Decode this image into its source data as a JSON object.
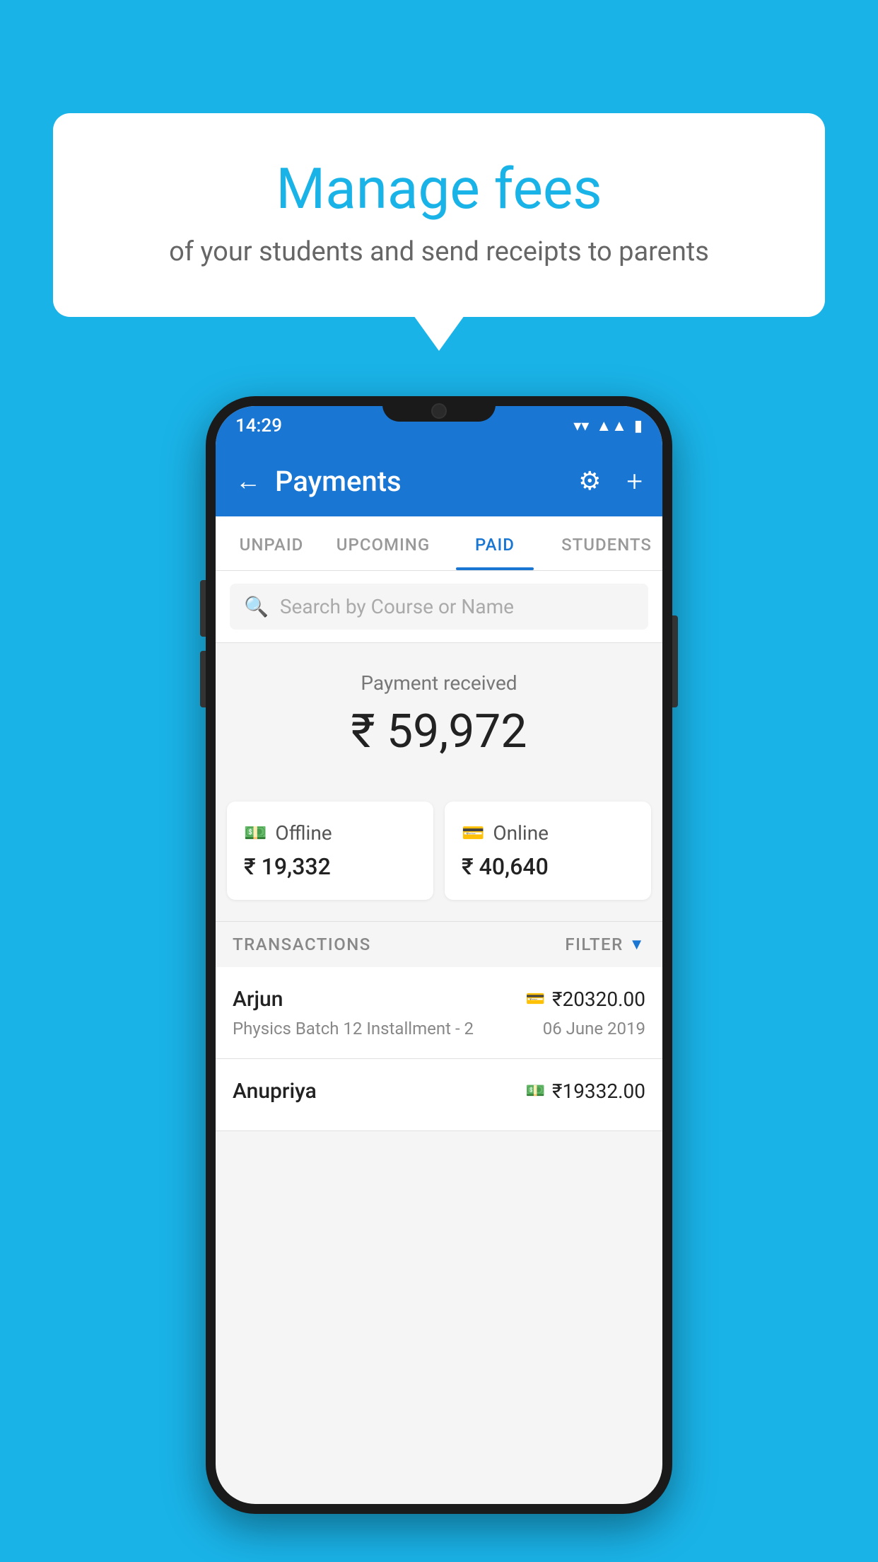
{
  "background_color": "#1ab3e8",
  "speech_bubble": {
    "title": "Manage fees",
    "subtitle": "of your students and send receipts to parents"
  },
  "phone": {
    "status_bar": {
      "time": "14:29",
      "wifi": "▾",
      "signal": "▲",
      "battery": "▮"
    },
    "header": {
      "back_label": "←",
      "title": "Payments",
      "gear_label": "⚙",
      "plus_label": "+"
    },
    "tabs": [
      {
        "label": "UNPAID",
        "active": false
      },
      {
        "label": "UPCOMING",
        "active": false
      },
      {
        "label": "PAID",
        "active": true
      },
      {
        "label": "STUDENTS",
        "active": false
      }
    ],
    "search": {
      "placeholder": "Search by Course or Name"
    },
    "payment_summary": {
      "label": "Payment received",
      "amount": "₹ 59,972",
      "offline_label": "Offline",
      "offline_amount": "₹ 19,332",
      "online_label": "Online",
      "online_amount": "₹ 40,640"
    },
    "transactions": {
      "section_label": "TRANSACTIONS",
      "filter_label": "FILTER",
      "items": [
        {
          "name": "Arjun",
          "amount": "₹20320.00",
          "detail": "Physics Batch 12 Installment - 2",
          "date": "06 June 2019",
          "payment_type": "online"
        },
        {
          "name": "Anupriya",
          "amount": "₹19332.00",
          "detail": "",
          "date": "",
          "payment_type": "offline"
        }
      ]
    }
  }
}
